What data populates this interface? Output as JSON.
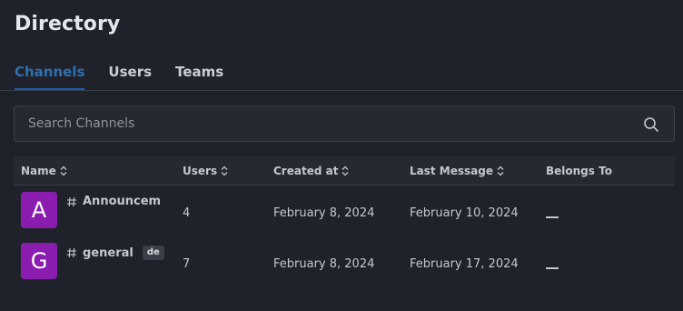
{
  "page": {
    "title": "Directory"
  },
  "tabs": [
    {
      "label": "Channels",
      "active": true
    },
    {
      "label": "Users",
      "active": false
    },
    {
      "label": "Teams",
      "active": false
    }
  ],
  "search": {
    "placeholder": "Search Channels",
    "value": ""
  },
  "table": {
    "columns": [
      {
        "label": "Name",
        "sortable": true
      },
      {
        "label": "Users",
        "sortable": true
      },
      {
        "label": "Created at",
        "sortable": true
      },
      {
        "label": "Last Message",
        "sortable": true
      },
      {
        "label": "Belongs To",
        "sortable": false
      }
    ],
    "rows": [
      {
        "avatar_letter": "A",
        "name": "Announceme",
        "badge": "",
        "users": "4",
        "created_at": "February 8, 2024",
        "last_message": "February 10, 2024",
        "belongs_to": "—"
      },
      {
        "avatar_letter": "G",
        "name": "general",
        "badge": "de",
        "users": "7",
        "created_at": "February 8, 2024",
        "last_message": "February 17, 2024",
        "belongs_to": "—"
      }
    ]
  },
  "colors": {
    "background": "#1f222b",
    "accent": "#1d5fb0",
    "avatar": "#8a1db0"
  },
  "icons": {
    "search": "search-icon",
    "sort": "sort-icon",
    "channel": "hash-icon"
  }
}
